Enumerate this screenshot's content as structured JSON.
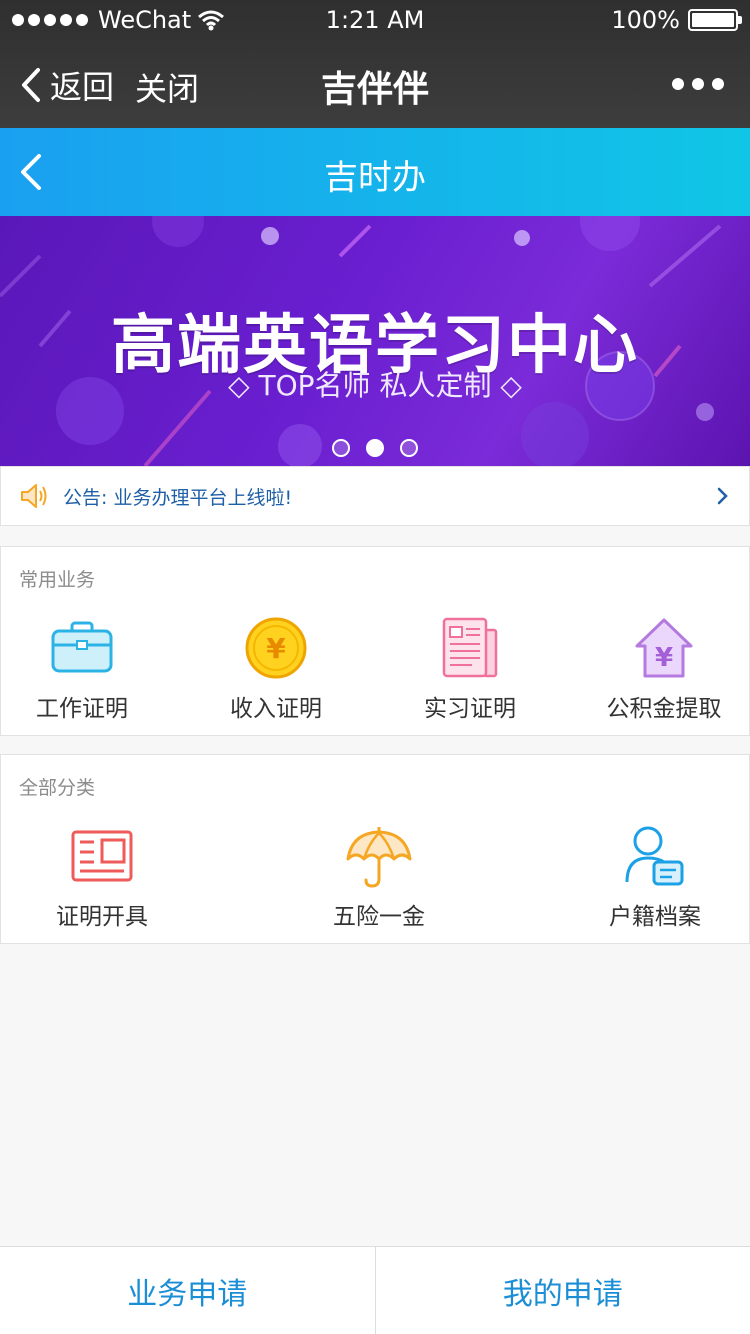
{
  "status_bar": {
    "carrier": "WeChat",
    "time": "1:21 AM",
    "battery": "100%"
  },
  "wechat_nav": {
    "back_label": "返回",
    "close_label": "关闭",
    "title": "吉伴伴"
  },
  "header": {
    "title": "吉时办"
  },
  "banner": {
    "title": "高端英语学习中心",
    "subtitle": "◇ TOP名师 私人定制 ◇",
    "page_count": 3,
    "active_page": 2
  },
  "notice": {
    "text": "公告: 业务办理平台上线啦!"
  },
  "common_services": {
    "title": "常用业务",
    "items": [
      {
        "label": "工作证明",
        "icon": "briefcase-icon"
      },
      {
        "label": "收入证明",
        "icon": "yuan-coin-icon"
      },
      {
        "label": "实习证明",
        "icon": "newspaper-icon"
      },
      {
        "label": "公积金提取",
        "icon": "house-yuan-icon"
      }
    ]
  },
  "all_categories": {
    "title": "全部分类",
    "items": [
      {
        "label": "证明开具",
        "icon": "certificate-icon"
      },
      {
        "label": "五险一金",
        "icon": "umbrella-icon"
      },
      {
        "label": "户籍档案",
        "icon": "person-card-icon"
      }
    ]
  },
  "bottom_bar": {
    "tabs": [
      {
        "label": "业务申请"
      },
      {
        "label": "我的申请"
      }
    ]
  },
  "colors": {
    "accent_blue": "#1b8ed6",
    "header_gradient_start": "#1aa0f0",
    "header_gradient_end": "#10c6e6",
    "banner_purple": "#6a1fd0"
  }
}
